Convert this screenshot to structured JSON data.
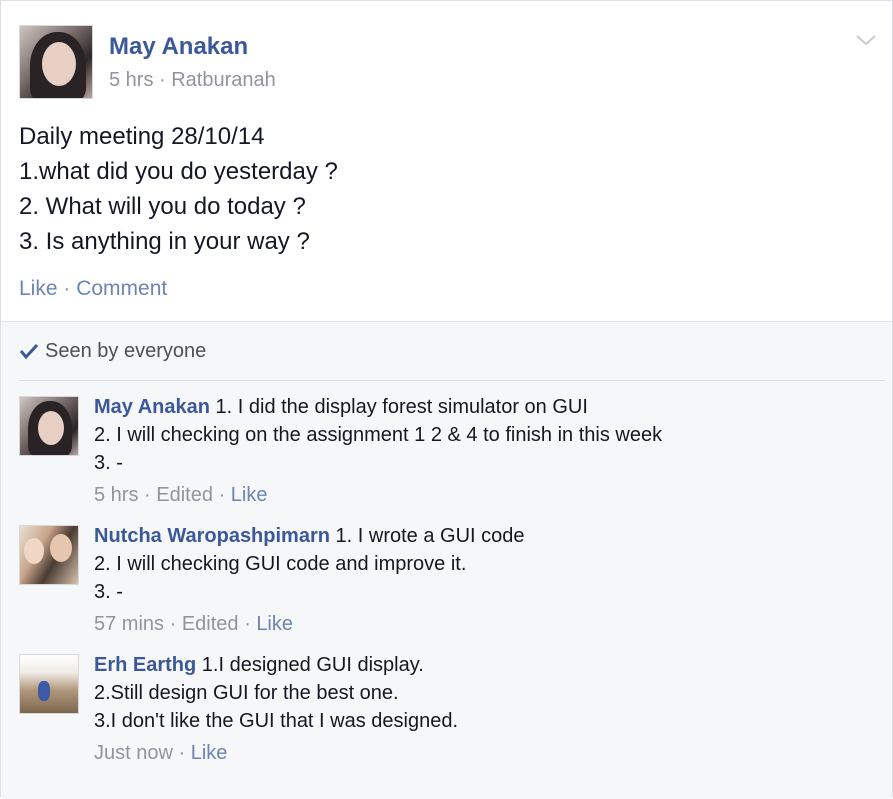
{
  "post": {
    "author": "May Anakan",
    "meta": "5 hrs · Ratburanah",
    "body": "Daily meeting 28/10/14\n1.what did you do yesterday ?\n2. What will you do today ?\n3. Is anything in your way ?",
    "actions": {
      "like": "Like",
      "comment": "Comment",
      "separator": " · "
    }
  },
  "seen": {
    "label": "Seen by everyone"
  },
  "comments": [
    {
      "author": "May Anakan",
      "text": " 1. I did the display forest simulator on GUI\n2. I will checking on the assignment 1 2 & 4 to finish in this week\n3. -",
      "time": "5 hrs",
      "edited": "Edited",
      "like": "Like"
    },
    {
      "author": "Nutcha Waropashpimarn",
      "text": " 1. I wrote a GUI code\n2. I will checking GUI code and improve it.\n3. -",
      "time": "57 mins",
      "edited": "Edited",
      "like": "Like"
    },
    {
      "author": "Erh Earthg",
      "text": " 1.I designed GUI display.\n2.Still design GUI for the best one.\n3.I don't like the GUI that I was designed.",
      "time": "Just now",
      "like": "Like"
    }
  ],
  "colors": {
    "link": "#3b5998",
    "muted": "#90949c",
    "background": "#f6f7f9"
  },
  "icons": {
    "menu": "chevron-down-icon",
    "seen": "checkmark-icon"
  }
}
